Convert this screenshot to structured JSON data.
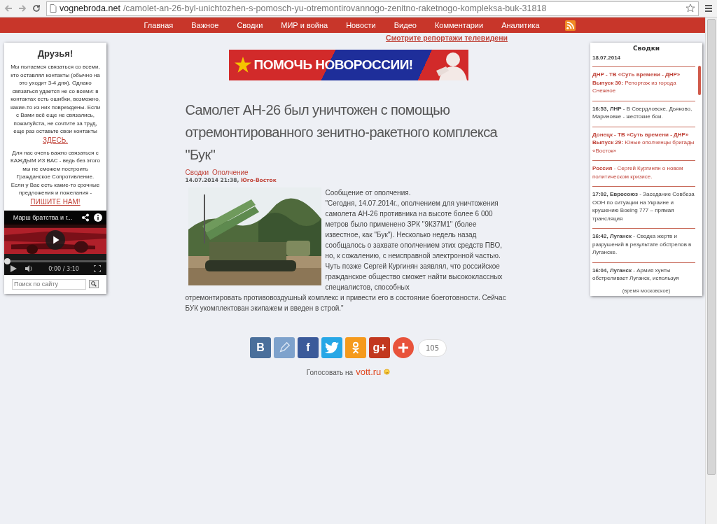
{
  "browser": {
    "url_host": "vognebroda.net",
    "url_path": "/camolet-an-26-byl-unichtozhen-s-pomosch-yu-otremontirovannogo-zenitno-raketnogo-kompleksa-buk-31818"
  },
  "nav": {
    "items": [
      "Главная",
      "Важное",
      "Сводки",
      "МИР и война",
      "Новости",
      "Видео",
      "Комментарии",
      "Аналитика"
    ],
    "promo_link": "Смотрите репортажи телевидени"
  },
  "friends": {
    "title": "Друзья!",
    "text1": "Мы пытаемся связаться со всеми, кто оставлял контакты (обычно на это уходит 3-4 дня). Однако связаться удается не со всеми: в контактах есть ошибки, возможно, какие-то из них повреждены. Если с Вами всё еще не связались, пожалуйста, не сочтите за труд, еще раз оставьте свои контакты",
    "link1": "ЗДЕСЬ.",
    "text2": "Для нас очень важно связаться с КАЖДЫМ ИЗ ВАС - ведь без этого мы не сможем построить Гражданское Сопротивление. Если у Вас есть какие-то срочные предложения и пожелания -",
    "link2": "ПИШИТЕ НАМ!"
  },
  "video": {
    "title": "Марш братства и г...",
    "time": "0:00 / 3:10",
    "level": 0
  },
  "site_search": {
    "placeholder": "Поиск по сайту"
  },
  "banner": {
    "text": "ПОМОЧЬ НОВОРОССИИ!"
  },
  "article": {
    "title": "Самолет АН-26 был уничтожен с помощью отремонтированного зенитно-ракетного комплекса \"Бук\"",
    "tags": [
      "Сводки",
      "Ополчение"
    ],
    "date": "14.07.2014 21:38,",
    "region": "Юго-Восток",
    "paragraphs": [
      "Сообщение от ополчения.",
      "\"Сегодня, 14.07.2014г., ополчением для уничтожения самолета АН-26 противника на высоте более 6 000 метров было применено ЗРК \"9К37М1\" (более известное, как \"Бук\"). Несколько недель назад сообщалось о захвате ополчением этих средств ПВО, но, к сожалению, с неисправной электронной частью. Чуть позже Сергей Кургинян заявлял, что российское гражданское общество сможет найти высококлассных специалистов, способных",
      "отремонтировать противовоздушный комплекс и привести его в состояние боеготовности. Сейчас БУК укомплектован экипажем и введен в строй.\""
    ]
  },
  "share": {
    "buttons": [
      {
        "kind": "vk",
        "label": "В",
        "color": "#4a6f9b"
      },
      {
        "kind": "pencil",
        "color": "#7ea2cc"
      },
      {
        "kind": "facebook",
        "label": "f",
        "color": "#3b5a9a"
      },
      {
        "kind": "twitter",
        "color": "#27a7e6"
      },
      {
        "kind": "ok",
        "color": "#f59a1c"
      },
      {
        "kind": "gplus",
        "label": "g+",
        "color": "#c2381f"
      },
      {
        "kind": "plus",
        "color": "#e8533b"
      }
    ],
    "count": "105"
  },
  "vote": {
    "label": "Голосовать на",
    "site": "vott.ru"
  },
  "summaries": {
    "title": "Сводки",
    "date": "18.07.2014",
    "footer": "(время московское)",
    "items": [
      {
        "text": "**ДНР - ТВ «Суть времени - ДНР» Выпуск 30:** Репортаж из города Снежное",
        "highlighted": true
      },
      {
        "text": "**16:53, ЛНР** - В Свердловске, Дьяково, Мариновке - жестокие бои.",
        "highlighted": false
      },
      {
        "text": "**Донецк - ТВ «Суть времени - ДНР» Выпуск 29:** Юные ополченцы бригады «Восток»",
        "highlighted": true
      },
      {
        "text": "**Россия** - Сергей Кургинян о новом политическом кризисе.",
        "highlighted": true
      },
      {
        "text": "**17:02, Евросоюз** - Заседание Совбеза ООН по ситуации на Украине и крушению Boeing 777 – прямая трансляция",
        "highlighted": false
      },
      {
        "text": "**16:42, Луганск** - Сводка жертв и разрушений в результате обстрелов в Луганске.",
        "highlighted": false
      },
      {
        "text": "**16:04, Луганск** - Армия хунты обстреливает Луганск, используя",
        "highlighted": false
      }
    ]
  }
}
